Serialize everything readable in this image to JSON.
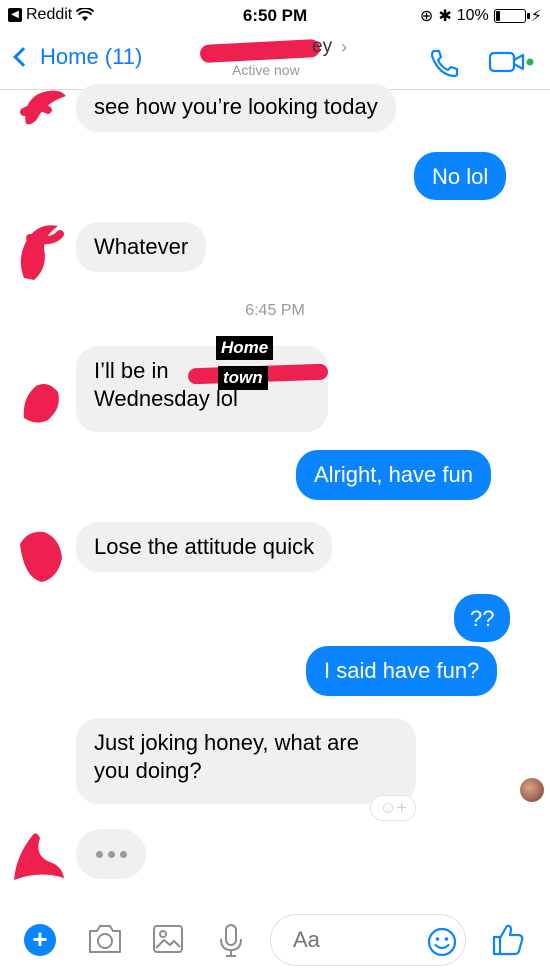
{
  "status_bar": {
    "back_app": "Reddit",
    "time": "6:50 PM",
    "battery": "10%"
  },
  "header": {
    "back_label": "Home (11)",
    "name_fragment": "ey",
    "active_status": "Active now"
  },
  "messages": [
    {
      "side": "in",
      "text": "see how you’re looking today"
    },
    {
      "side": "out",
      "text": "No lol"
    },
    {
      "side": "in",
      "text": "Whatever"
    },
    {
      "side": "in",
      "text": "I’ll be in",
      "text2": "Wednesday lol"
    },
    {
      "side": "out",
      "text": "Alright, have fun"
    },
    {
      "side": "in",
      "text": "Lose the attitude quick"
    },
    {
      "side": "out",
      "text": "??"
    },
    {
      "side": "out",
      "text": "I said have fun?"
    },
    {
      "side": "in",
      "text": "Just joking honey, what are",
      "text2": "you doing?"
    }
  ],
  "timestamp": "6:45 PM",
  "overlay": {
    "line1": "Home",
    "line2": "town"
  },
  "composer": {
    "placeholder": "Aa"
  },
  "colors": {
    "accent": "#0a84ff",
    "incoming_bubble": "#f1f0f0",
    "redaction": "#ee2050"
  },
  "icons": [
    "wifi-icon",
    "bluetooth-icon",
    "phone-icon",
    "video-icon",
    "plus-icon",
    "camera-icon",
    "gallery-icon",
    "microphone-icon",
    "emoji-icon",
    "thumbs-up-icon"
  ]
}
